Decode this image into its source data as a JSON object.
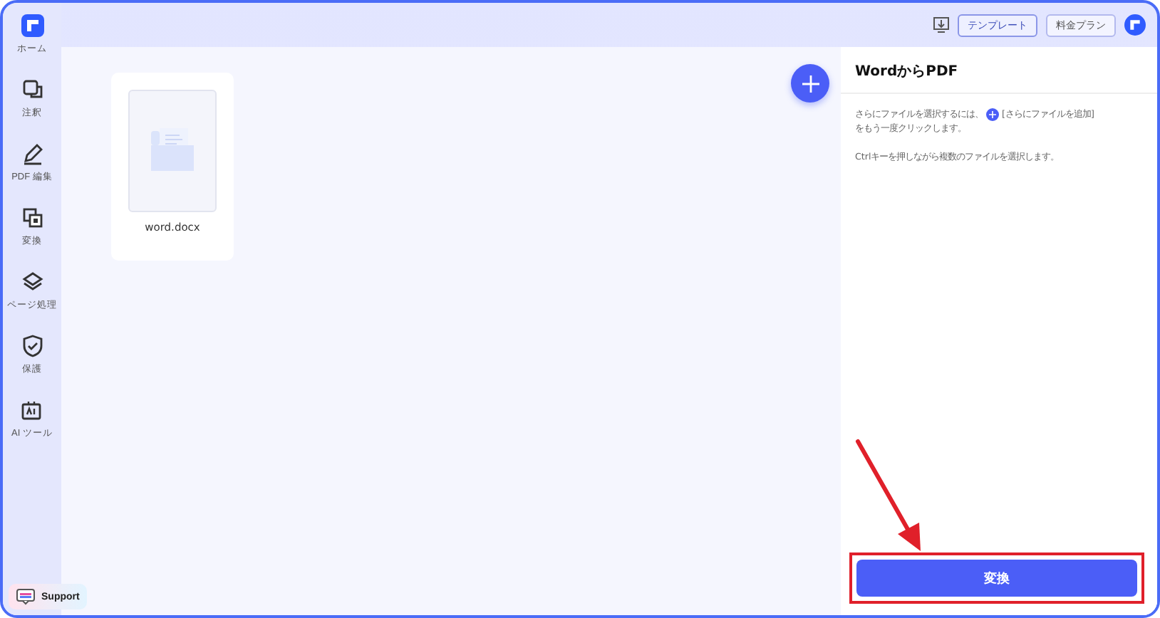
{
  "sidebar": {
    "items": [
      {
        "label": "ホーム",
        "kind": "logo"
      },
      {
        "label": "注釈",
        "kind": "comment"
      },
      {
        "label": "PDF 編集",
        "kind": "edit"
      },
      {
        "label": "変換",
        "kind": "convert"
      },
      {
        "label": "ページ処理",
        "kind": "layers"
      },
      {
        "label": "保護",
        "kind": "shield"
      },
      {
        "label": "AI ツール",
        "kind": "ai"
      }
    ],
    "support": "Support"
  },
  "top_bar": {
    "buttons": [
      "テンプレート",
      "料金プラン"
    ]
  },
  "files": [
    {
      "name": "word.docx"
    }
  ],
  "panel": {
    "title": "WordからPDF",
    "hint_before": "さらにファイルを選択するには、",
    "hint_after": "[さらにファイルを追加]",
    "hint_after_2": "をもう一度クリックします。",
    "hint_2": "Ctrlキーを押しながら複数のファイルを選択します。",
    "convert_button": "変換"
  }
}
